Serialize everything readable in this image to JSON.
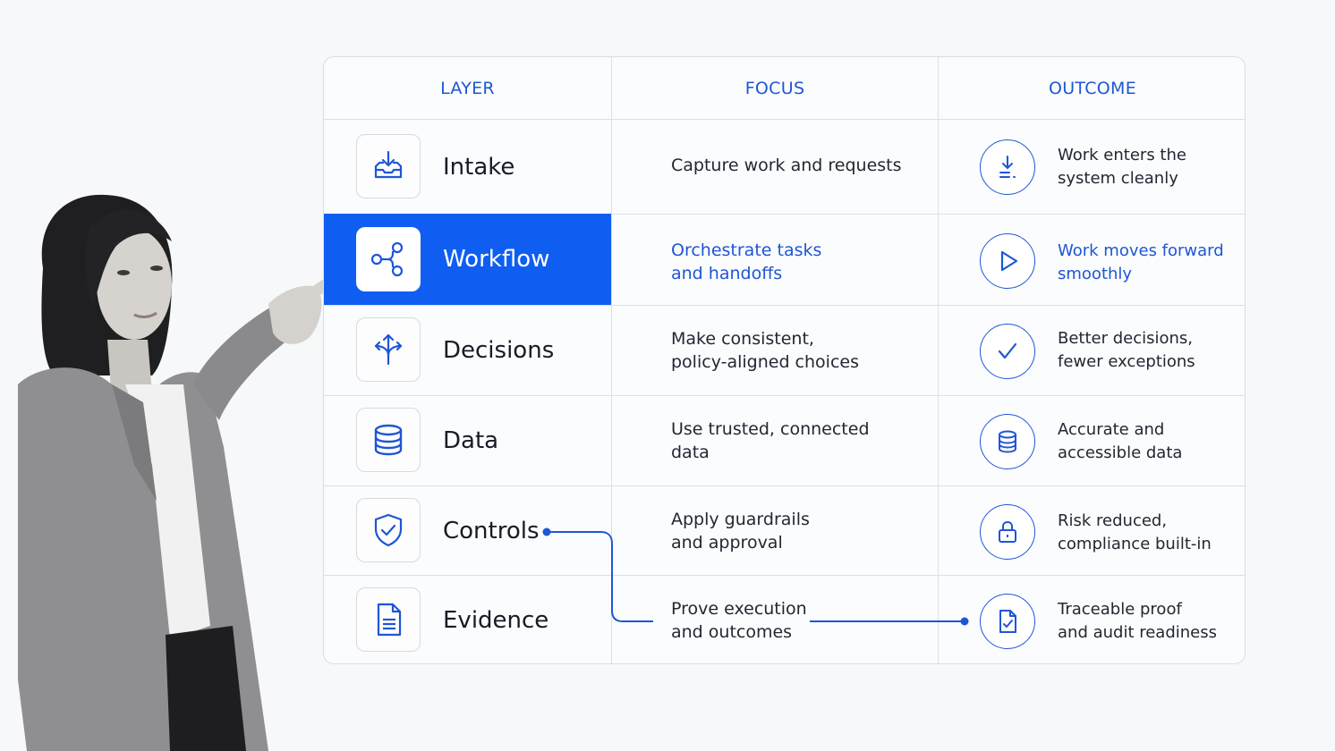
{
  "headers": {
    "layer": "LAYER",
    "focus": "FOCUS",
    "outcome": "OUTCOME"
  },
  "rows": [
    {
      "layer": "Intake",
      "layer_icon": "inbox-download-icon",
      "focus": "Capture work and requests",
      "outcome_icon": "download-icon",
      "outcome": "Work enters the\nsystem cleanly",
      "active": false
    },
    {
      "layer": "Workflow",
      "layer_icon": "workflow-nodes-icon",
      "focus": "Orchestrate tasks\nand handoffs",
      "outcome_icon": "play-icon",
      "outcome": "Work moves forward\nsmoothly",
      "active": true
    },
    {
      "layer": "Decisions",
      "layer_icon": "branching-arrows-icon",
      "focus": "Make consistent,\npolicy-aligned choices",
      "outcome_icon": "checkmark-icon",
      "outcome": "Better decisions,\nfewer exceptions",
      "active": false
    },
    {
      "layer": "Data",
      "layer_icon": "database-icon",
      "focus": "Use trusted, connected\ndata",
      "outcome_icon": "database-icon",
      "outcome": "Accurate and\naccessible data",
      "active": false
    },
    {
      "layer": "Controls",
      "layer_icon": "shield-check-icon",
      "focus": "Apply guardrails\nand approval",
      "outcome_icon": "lock-icon",
      "outcome": "Risk reduced,\ncompliance built-in",
      "active": false
    },
    {
      "layer": "Evidence",
      "layer_icon": "document-icon",
      "focus": "Prove execution\nand outcomes",
      "outcome_icon": "document-check-icon",
      "outcome": "Traceable proof\nand audit readiness",
      "active": false
    }
  ],
  "colors": {
    "accent": "#0f5ef1",
    "accent_text": "#1e56d6",
    "border": "#dcdfe4",
    "background": "#f7f8fa"
  }
}
